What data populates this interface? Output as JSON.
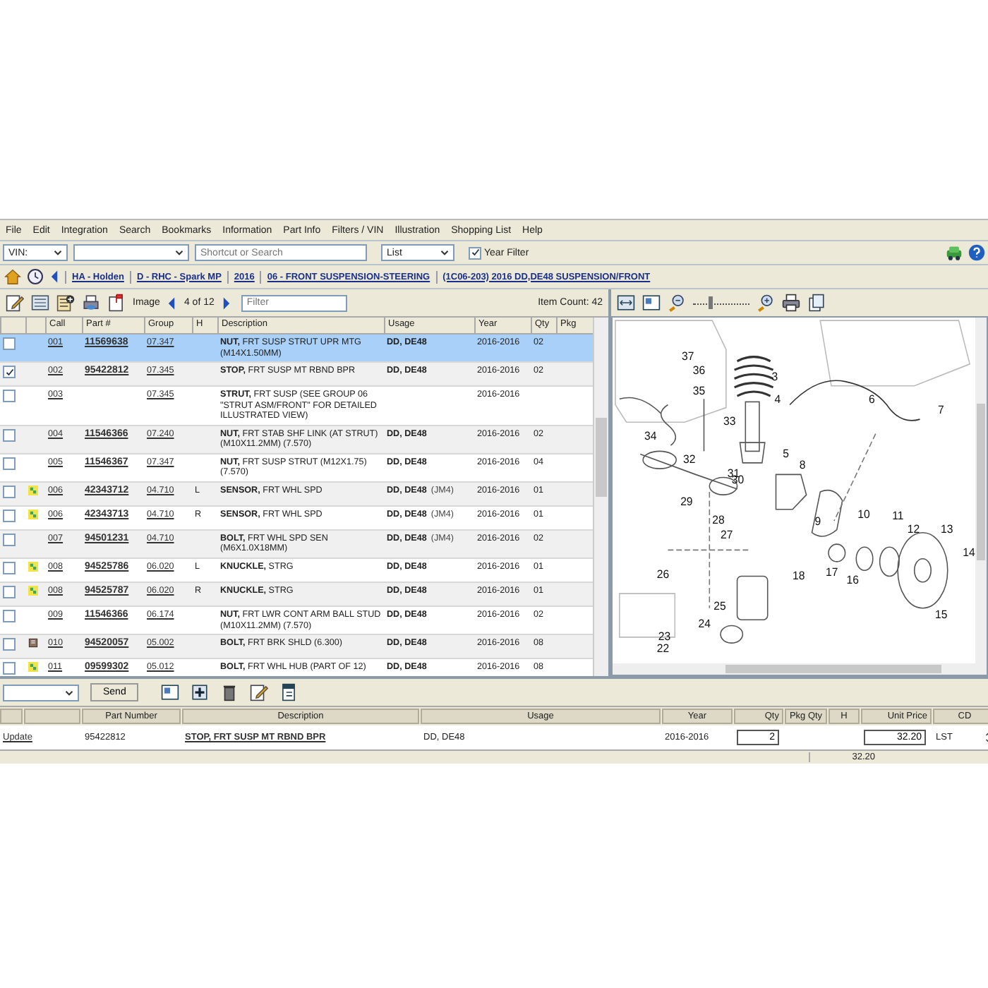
{
  "menu": [
    "File",
    "Edit",
    "Integration",
    "Search",
    "Bookmarks",
    "Information",
    "Part Info",
    "Filters / VIN",
    "Illustration",
    "Shopping List",
    "Help"
  ],
  "vin_bar": {
    "vin_label": "VIN:",
    "search_placeholder": "Shortcut or Search",
    "view_select": "List",
    "year_filter": {
      "label": "Year Filter",
      "checked": true
    }
  },
  "breadcrumb": [
    "HA - Holden",
    "D - RHC - Spark MP",
    "2016",
    "06 - FRONT SUSPENSION-STEERING",
    "(1C06-203)  2016  DD,DE48 SUSPENSION/FRONT"
  ],
  "image_nav": {
    "label": "Image",
    "page": "4 of 12",
    "filter_placeholder": "Filter",
    "item_count": "Item Count: 42"
  },
  "table": {
    "columns": [
      "Call",
      "Part #",
      "Group",
      "H",
      "Description",
      "Usage",
      "Year",
      "Qty",
      "Pkg"
    ],
    "rows": [
      {
        "call": "001",
        "part": "11569638",
        "group": "07.347",
        "h": "",
        "description": "**NUT,** FRT SUSP STRUT UPR MTG (M14X1.50MM)",
        "usage": "DD, DE48",
        "year": "2016-2016",
        "qty": "02",
        "checked": false,
        "selected": true
      },
      {
        "call": "002",
        "part": "95422812",
        "group": "07.345",
        "h": "",
        "description": "**STOP,** FRT SUSP MT RBND BPR",
        "usage": "DD, DE48",
        "year": "2016-2016",
        "qty": "02",
        "checked": true,
        "selected": false
      },
      {
        "call": "003",
        "part": "",
        "group": "07.345",
        "h": "",
        "description": "**STRUT,** FRT SUSP (SEE GROUP 06 \"STRUT ASM/FRONT\" FOR DETAILED ILLUSTRATED VIEW)",
        "usage": "",
        "year": "2016-2016",
        "qty": "",
        "checked": false,
        "selected": false
      },
      {
        "call": "004",
        "part": "11546366",
        "group": "07.240",
        "h": "",
        "description": "**NUT,** FRT STAB SHF LINK (AT STRUT) (M10X11.2MM) (7.570)",
        "usage": "DD, DE48",
        "year": "2016-2016",
        "qty": "02",
        "checked": false,
        "selected": false
      },
      {
        "call": "005",
        "part": "11546367",
        "group": "07.347",
        "h": "",
        "description": "**NUT,** FRT SUSP STRUT (M12X1.75) (7.570)",
        "usage": "DD, DE48",
        "year": "2016-2016",
        "qty": "04",
        "checked": false,
        "selected": false
      },
      {
        "call": "006",
        "part": "42343712",
        "group": "04.710",
        "h": "L",
        "description": "**SENSOR,** FRT WHL SPD",
        "usage": "DD, DE48",
        "usage_note": "(JM4)",
        "year": "2016-2016",
        "qty": "01",
        "kind": "tag",
        "checked": false,
        "selected": false
      },
      {
        "call": "006",
        "part": "42343713",
        "group": "04.710",
        "h": "R",
        "description": "**SENSOR,** FRT WHL SPD",
        "usage": "DD, DE48",
        "usage_note": "(JM4)",
        "year": "2016-2016",
        "qty": "01",
        "kind": "tag",
        "checked": false,
        "selected": false
      },
      {
        "call": "007",
        "part": "94501231",
        "group": "04.710",
        "h": "",
        "description": "**BOLT,** FRT WHL SPD SEN (M6X1.0X18MM)",
        "usage": "DD, DE48",
        "usage_note": "(JM4)",
        "year": "2016-2016",
        "qty": "02",
        "checked": false,
        "selected": false
      },
      {
        "call": "008",
        "part": "94525786",
        "group": "06.020",
        "h": "L",
        "description": "**KNUCKLE,** STRG",
        "usage": "DD, DE48",
        "year": "2016-2016",
        "qty": "01",
        "kind": "tag",
        "checked": false,
        "selected": false
      },
      {
        "call": "008",
        "part": "94525787",
        "group": "06.020",
        "h": "R",
        "description": "**KNUCKLE,** STRG",
        "usage": "DD, DE48",
        "year": "2016-2016",
        "qty": "01",
        "kind": "tag",
        "checked": false,
        "selected": false
      },
      {
        "call": "009",
        "part": "11546366",
        "group": "06.174",
        "h": "",
        "description": "**NUT,** FRT LWR CONT ARM BALL STUD (M10X11.2MM) (7.570)",
        "usage": "DD, DE48",
        "year": "2016-2016",
        "qty": "02",
        "checked": false,
        "selected": false
      },
      {
        "call": "010",
        "part": "94520057",
        "group": "05.002",
        "h": "",
        "description": "**BOLT,** FRT BRK SHLD (6.300)",
        "usage": "DD, DE48",
        "year": "2016-2016",
        "qty": "08",
        "kind": "book",
        "checked": false,
        "selected": false
      },
      {
        "call": "011",
        "part": "09599302",
        "group": "05.012",
        "h": "",
        "description": "**BOLT,** FRT WHL HUB (PART OF 12)",
        "usage": "DD, DE48",
        "year": "2016-2016",
        "qty": "08",
        "kind": "tag",
        "checked": false,
        "selected": false
      }
    ]
  },
  "illustration": {
    "zoom": {
      "level": 0.3
    },
    "callouts": [
      "37",
      "36",
      "3",
      "35",
      "4",
      "6",
      "7",
      "33",
      "34",
      "5",
      "32",
      "31",
      "8",
      "30",
      "29",
      "10",
      "28",
      "9",
      "11",
      "12",
      "13",
      "27",
      "14",
      "18",
      "17",
      "16",
      "26",
      "15",
      "25",
      "24",
      "23",
      "22"
    ]
  },
  "cart": {
    "send": "Send",
    "columns": [
      "Part Number",
      "Description",
      "Usage",
      "Year",
      "Qty",
      "Pkg Qty",
      "H",
      "Unit Price",
      "CD"
    ],
    "rows": [
      {
        "action": "Update",
        "part": "95422812",
        "description": "STOP, FRT SUSP MT RBND BPR",
        "usage": "DD, DE48",
        "year": "2016-2016",
        "qty": "2",
        "unit_price": "32.20",
        "cd": "LST"
      }
    ],
    "total": "32.20"
  }
}
